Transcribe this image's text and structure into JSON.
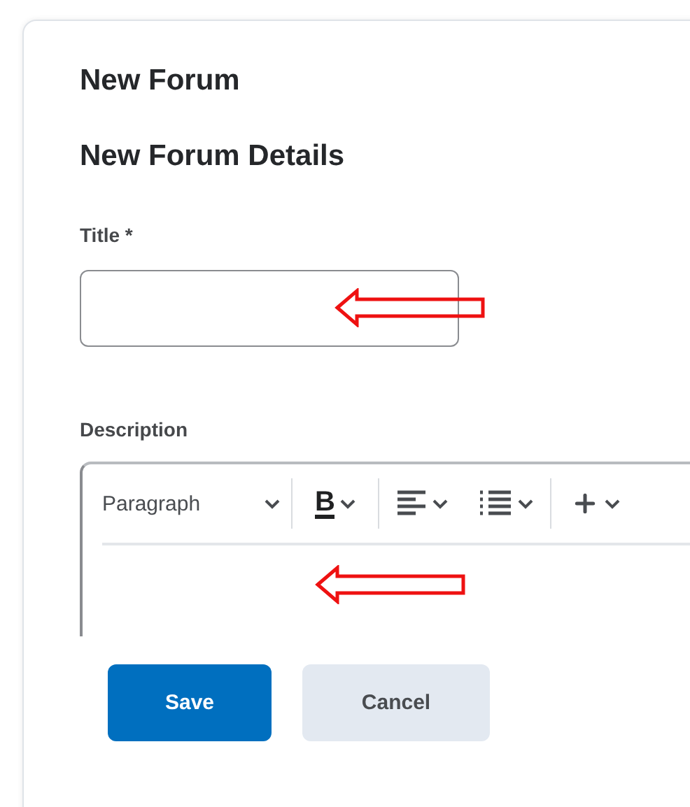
{
  "dialog": {
    "title": "New Forum",
    "section_title": "New Forum Details"
  },
  "fields": [
    {
      "kind": "text",
      "label": "Title *"
    },
    {
      "kind": "editor",
      "label": "Description",
      "toolbar": {
        "block_format": "Paragraph",
        "bold": "B"
      }
    }
  ],
  "buttons": [
    {
      "label": "Save",
      "kind": "primary"
    },
    {
      "label": "Cancel",
      "kind": "secondary"
    }
  ]
}
